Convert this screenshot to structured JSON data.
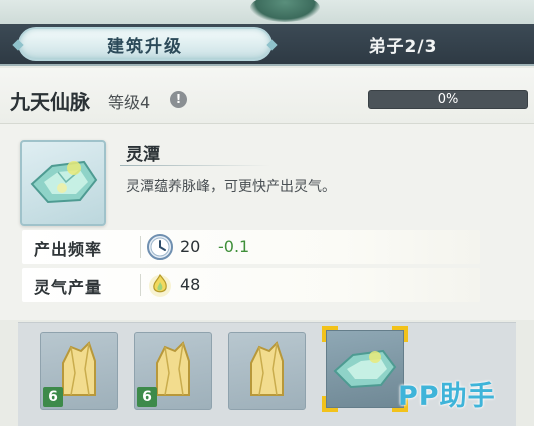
{
  "tabs": {
    "active_label": "建筑升级",
    "inactive_label": "弟子2/3"
  },
  "building": {
    "name": "九天仙脉",
    "level_label": "等级4",
    "info_glyph": "!",
    "progress": 0,
    "progress_text": "0%"
  },
  "item": {
    "title": "灵潭",
    "description": "灵潭蕴养脉峰，可更快产出灵气。"
  },
  "stats": [
    {
      "label": "产出频率",
      "value": "20",
      "delta": "-0.1",
      "icon": "clock-icon"
    },
    {
      "label": "灵气产量",
      "value": "48",
      "delta": "",
      "icon": "spirit-flame-icon"
    }
  ],
  "materials": [
    {
      "icon": "spirit-crystal-icon",
      "count": "6"
    },
    {
      "icon": "spirit-crystal-icon",
      "count": "6"
    },
    {
      "icon": "spirit-crystal-icon",
      "count": ""
    },
    {
      "icon": "jade-pool-icon",
      "count": "",
      "selected": true
    }
  ],
  "watermark": "PP助手",
  "colors": {
    "tab_bar": "#2e3a44",
    "active_tab": "#dbecee",
    "delta_green": "#3f8f3a",
    "count_badge": "#3d8a4a",
    "selection": "#f2c21b",
    "watermark": "#3fb4d9"
  }
}
